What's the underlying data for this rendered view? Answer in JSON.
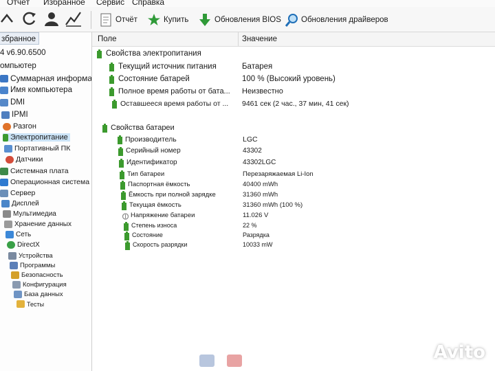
{
  "menu": {
    "items": [
      "Отчёт",
      "Избранное",
      "Сервис",
      "Справка"
    ]
  },
  "toolbar": {
    "report": "Отчёт",
    "buy": "Купить",
    "bios_updates": "Обновления BIOS",
    "driver_updates": "Обновления драйверов"
  },
  "left_panel": {
    "tab": "збранное",
    "version": "4 v6.90.6500",
    "items": [
      "омпьютер",
      "Суммарная информа",
      "Имя компьютера",
      "DMI",
      "IPMI",
      "Разгон",
      "Электропитание",
      "Портативный ПК",
      "Датчики",
      "Системная плата",
      "Операционная система",
      "Сервер",
      "Дисплей",
      "Мультимедиа",
      "Хранение данных",
      "Сеть",
      "DirectX",
      "Устройства",
      "Программы",
      "Безопасность",
      "Конфигурация",
      "База данных",
      "Тесты"
    ]
  },
  "columns": {
    "field": "Поле",
    "value": "Значение"
  },
  "sections": [
    {
      "title": "Свойства электропитания",
      "rows": [
        {
          "field": "Текущий источник питания",
          "value": "Батарея"
        },
        {
          "field": "Состояние батарей",
          "value": "100 % (Высокий уровень)"
        },
        {
          "field": "Полное время работы от бата...",
          "value": "Неизвестно"
        },
        {
          "field": "Оставшееся время работы от ...",
          "value": "9461 сек (2 час., 37 мин, 41 сек)"
        }
      ]
    },
    {
      "title": "Свойства батареи",
      "rows": [
        {
          "field": "Производитель",
          "value": "LGC"
        },
        {
          "field": "Серийный номер",
          "value": "43302"
        },
        {
          "field": "Идентификатор",
          "value": "43302LGC"
        },
        {
          "field": "Тип батареи",
          "value": "Перезаряжаемая Li-Ion"
        },
        {
          "field": "Паспортная ёмкость",
          "value": "40400 mWh"
        },
        {
          "field": "Ёмкость при полной зарядке",
          "value": "31360 mWh"
        },
        {
          "field": "Текущая ёмкость",
          "value": "31360 mWh  (100 %)"
        },
        {
          "field": "Напряжение батареи",
          "value": "11.026 V"
        },
        {
          "field": "Степень износа",
          "value": "22 %"
        },
        {
          "field": "Состояние",
          "value": "Разрядка"
        },
        {
          "field": "Скорость разрядки",
          "value": "10033 mW"
        }
      ]
    }
  ],
  "watermark": "Avito",
  "colors": {
    "accent_green": "#3c9a2e",
    "selection": "#cce4f7",
    "bios_green": "#2f9a38"
  }
}
